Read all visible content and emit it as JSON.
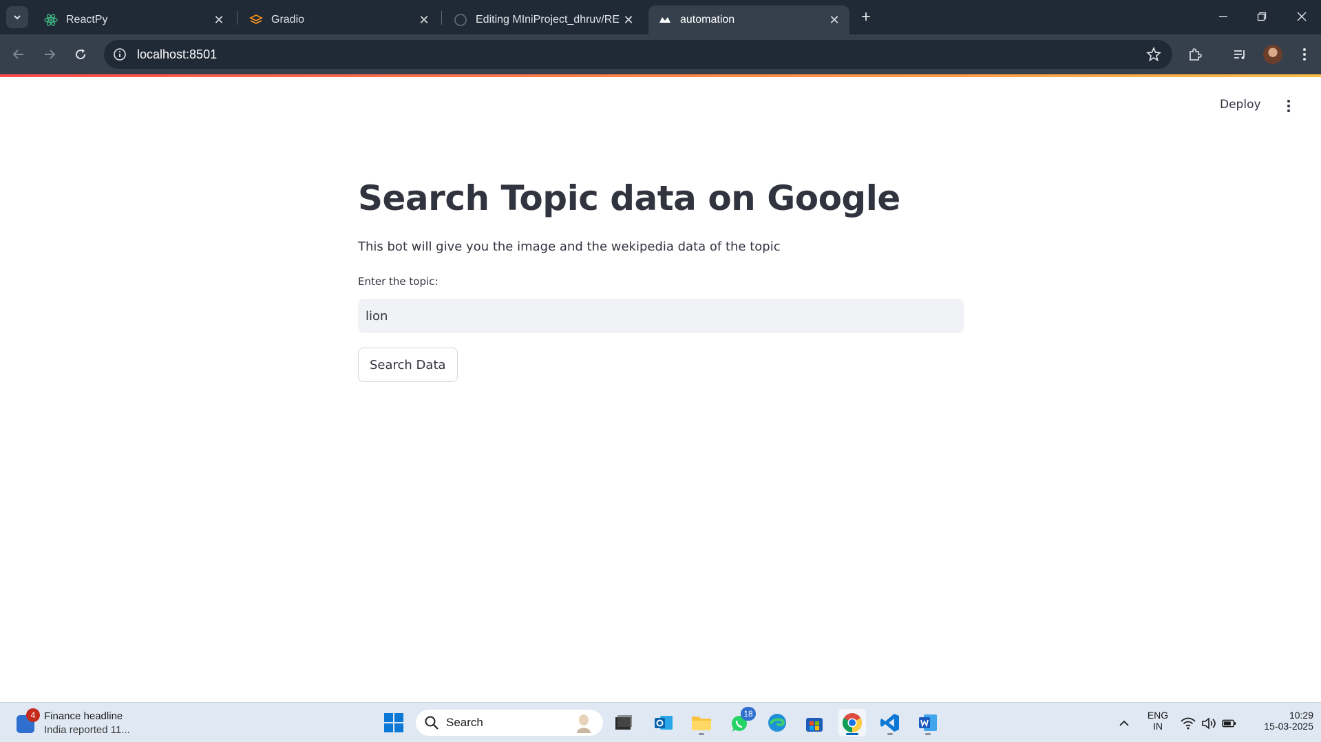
{
  "browser": {
    "tabs": [
      {
        "title": "ReactPy",
        "icon": "reactpy-icon"
      },
      {
        "title": "Gradio",
        "icon": "gradio-icon"
      },
      {
        "title": "Editing MIniProject_dhruv/READ",
        "icon": "github-icon"
      },
      {
        "title": "automation",
        "icon": "streamlit-icon",
        "active": true
      }
    ],
    "url": "localhost:8501",
    "accent_gradient": [
      "#ff4b4b",
      "#ffbd45"
    ]
  },
  "app": {
    "deploy_label": "Deploy",
    "title": "Search Topic data on Google",
    "description": "This bot will give you the image and the wekipedia data of the topic",
    "input_label": "Enter the topic:",
    "input_value": "lion",
    "button_label": "Search Data"
  },
  "taskbar": {
    "widget_badge": "4",
    "widget_title": "Finance headline",
    "widget_subtitle": "India reported 11...",
    "search_label": "Search",
    "whatsapp_badge": "18",
    "language": "ENG",
    "region": "IN",
    "time": "10:29",
    "date": "15-03-2025"
  }
}
